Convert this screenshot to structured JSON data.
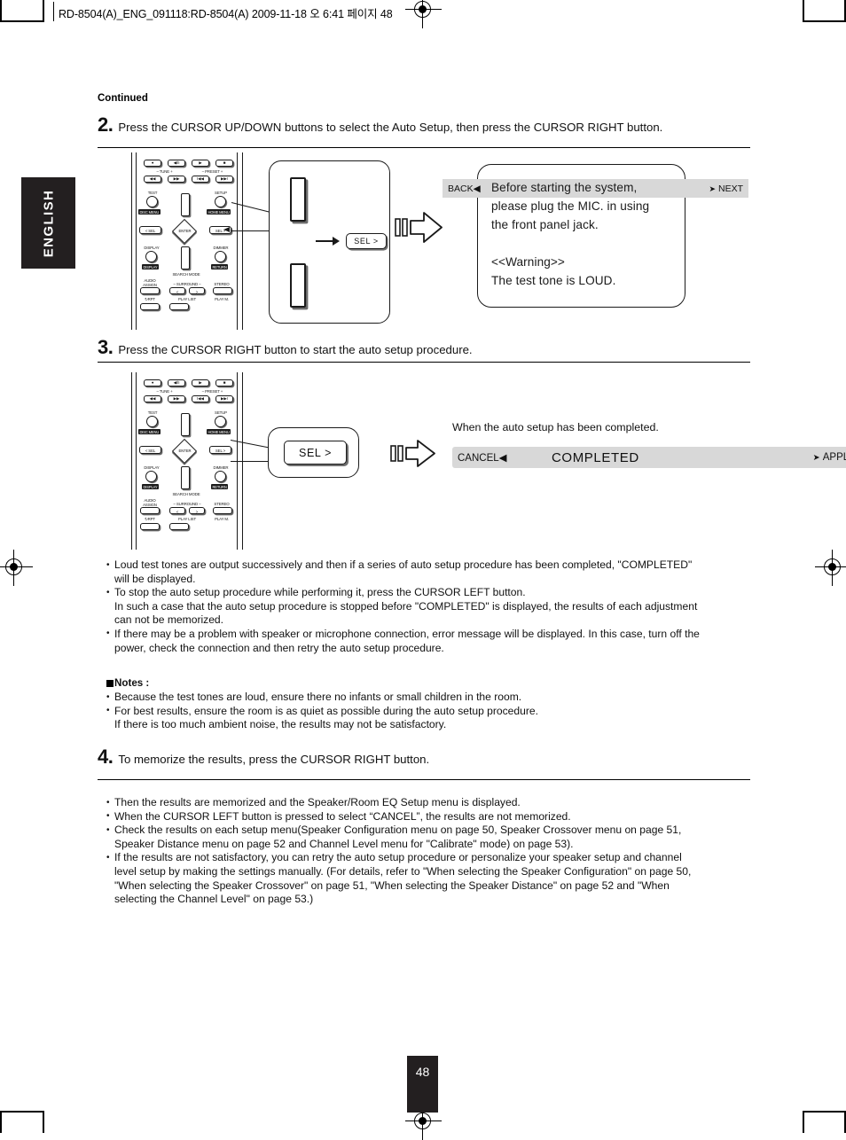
{
  "slug": "RD-8504(A)_ENG_091118:RD-8504(A)  2009-11-18  오   6:41  페이지 48",
  "language_tab": "ENGLISH",
  "continued_label": "Continued",
  "page_number": "48",
  "steps": [
    {
      "number": "2.",
      "text": "Press the CURSOR UP/DOWN buttons to select the Auto Setup, then press the CURSOR RIGHT button."
    },
    {
      "number": "3.",
      "text": "Press the CURSOR RIGHT button to start the auto setup procedure."
    },
    {
      "number": "4.",
      "text": "To memorize the results, press the CURSOR RIGHT button."
    }
  ],
  "remote": {
    "top_row_glyphs": [
      "●",
      "◀/II",
      "▶",
      "■"
    ],
    "tune_label": "–  TUNE  +",
    "preset_label": "–  PRESET  +",
    "second_row_glyphs": [
      "◀◀",
      "▶▶",
      "I◀◀",
      "▶▶I"
    ],
    "test_label": "TEST",
    "disc_menu_label": "DISC MENU",
    "setup_label": "SETUP",
    "home_menu_label": "HOME MENU",
    "sel_left_label": "< SEL",
    "enter_label": "ENTER",
    "sel_right_label": "SEL >",
    "display_label": "DISPLAY",
    "display_box_label": "DISPLAY",
    "search_mode_label": "SEARCH MODE",
    "dimmer_label": "DIMMER",
    "return_label": "RETURN",
    "audio_assign_label": "AUDIO\nASSIGN",
    "surround_label": "–  SURROUND  –",
    "surround_left_glyph": "<",
    "surround_right_glyph": ">",
    "stereo_label": "STEREO",
    "rpt_label": "↻RPT",
    "play_list_label": "PLAY LIST",
    "play_m_label": "PLAY M."
  },
  "callout": {
    "sel_button_label": "SEL >"
  },
  "osd_step2": {
    "back_label": "BACK",
    "back_arrow": "◀",
    "next_arrow": "➤",
    "next_label": "NEXT",
    "line1": "Before starting the system,",
    "line2": "please plug the MIC. in using",
    "line3": "the front panel jack.",
    "line4": "<<Warning>>",
    "line5": "The test tone is LOUD."
  },
  "osd_step3": {
    "caption": "When the auto setup has been completed.",
    "cancel_label": "CANCEL",
    "cancel_arrow": "◀",
    "status": "COMPLETED",
    "apply_arrow": "➤",
    "apply_label": "APPLY"
  },
  "bullets_after_step3": [
    {
      "lines": [
        "Loud test tones are output successively and then if a series of auto setup procedure has been completed, \"COMPLETED\"",
        "will be displayed."
      ]
    },
    {
      "lines": [
        "To stop the auto setup procedure while performing it, press the CURSOR LEFT button.",
        "In such a case that the auto setup procedure is stopped before \"COMPLETED\" is displayed, the results of each adjustment",
        "can not be memorized."
      ]
    },
    {
      "lines": [
        "If there may be a problem with speaker or microphone connection, error message will be displayed. In this case, turn off the",
        "power, check the connection and then retry the auto setup procedure."
      ]
    }
  ],
  "notes": {
    "heading": "Notes :",
    "items": [
      {
        "lines": [
          "Because the test tones are loud, ensure there no infants or small children in the room."
        ]
      },
      {
        "lines": [
          "For best results, ensure the room is as quiet as possible during the auto setup procedure.",
          "If there is too much ambient noise, the results may not be satisfactory."
        ]
      }
    ]
  },
  "bullets_after_step4": [
    {
      "lines": [
        "Then the results are memorized and the Speaker/Room EQ Setup menu is displayed."
      ]
    },
    {
      "lines": [
        "When the CURSOR LEFT button is pressed to select “CANCEL”, the results are not memorized."
      ]
    },
    {
      "lines": [
        "Check the results on each setup menu(Speaker Configuration menu on page 50, Speaker Crossover menu on page 51,",
        "Speaker Distance menu on page 52 and Channel Level menu for \"Calibrate\" mode) on page 53)."
      ]
    },
    {
      "lines": [
        "If the results are not satisfactory, you can retry the auto setup procedure or personalize your speaker setup and channel",
        "level setup by making the settings manually. (For details, refer to \"When selecting the Speaker Configuration\" on page 50,",
        "\"When selecting the Speaker Crossover\" on page 51, \"When selecting the Speaker Distance\" on page 52 and \"When",
        "selecting the Channel Level\" on page 53.)"
      ]
    }
  ],
  "colors": {
    "ink": "#111111",
    "tab_fill": "#231f20",
    "osd_bar_fill": "#d8d8d8",
    "button_shadow": "#6b6b6b"
  }
}
